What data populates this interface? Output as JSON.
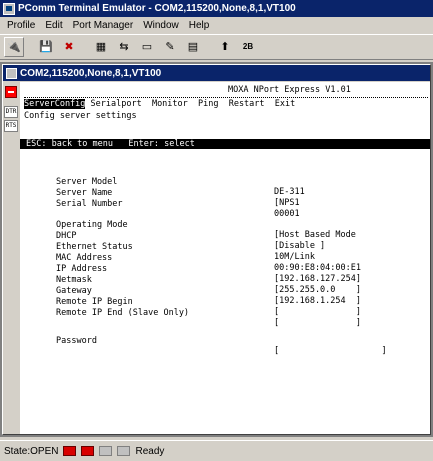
{
  "app": {
    "title": "PComm Terminal Emulator - COM2,115200,None,8,1,VT100"
  },
  "menubar": {
    "items": [
      {
        "label": "Profile"
      },
      {
        "label": "Edit"
      },
      {
        "label": "Port Manager"
      },
      {
        "label": "Window"
      },
      {
        "label": "Help"
      }
    ]
  },
  "toolbar": {
    "buttons": [
      {
        "icon": "connect-icon",
        "glyph": "🔌"
      },
      {
        "icon": "save-icon",
        "glyph": "💾"
      },
      {
        "icon": "disconnect-icon",
        "glyph": "✖"
      },
      {
        "icon": "properties-icon",
        "glyph": "▦"
      },
      {
        "icon": "transfer-icon",
        "glyph": "⇆"
      },
      {
        "icon": "capture-icon",
        "glyph": "▭"
      },
      {
        "icon": "script-icon",
        "glyph": "✎"
      },
      {
        "icon": "log-icon",
        "glyph": "▤"
      },
      {
        "icon": "send-file-icon",
        "glyph": "⬆"
      },
      {
        "icon": "receive-file-icon",
        "glyph": "2B"
      }
    ]
  },
  "child_window": {
    "title": "COM2,115200,None,8,1,VT100"
  },
  "left_strip": {
    "tags": [
      "DTR",
      "RTS"
    ]
  },
  "terminal": {
    "header": "MOXA NPort Express V1.01",
    "menu_selected": "ServerConfig",
    "menu_rest": " Serialport  Monitor  Ping  Restart  Exit",
    "subtitle": "Config server settings",
    "hint_bar": "ESC: back to menu   Enter: select",
    "fields": [
      {
        "label": "Server Model",
        "value": "DE-311"
      },
      {
        "label": "Server Name",
        "value": "[NPS1"
      },
      {
        "label": "Serial Number",
        "value": "00001"
      },
      {
        "label": "Operating Mode",
        "value": "[Host Based Mode"
      },
      {
        "label": "DHCP",
        "value": "[Disable ]"
      },
      {
        "label": "Ethernet Status",
        "value": "10M/Link"
      },
      {
        "label": "MAC Address",
        "value": "00:90:E8:04:00:E1"
      },
      {
        "label": "IP Address",
        "value": "[192.168.127.254]"
      },
      {
        "label": "Netmask",
        "value": "[255.255.0.0    ]"
      },
      {
        "label": "Gateway",
        "value": "[192.168.1.254  ]"
      },
      {
        "label": "Remote IP Begin",
        "value": "[               ]"
      },
      {
        "label": "Remote IP End (Slave Only)",
        "value": "[               ]"
      },
      {
        "label": "Password",
        "value": "[                    ]"
      }
    ]
  },
  "statusbar": {
    "state": "State:OPEN",
    "ready": "Ready"
  }
}
